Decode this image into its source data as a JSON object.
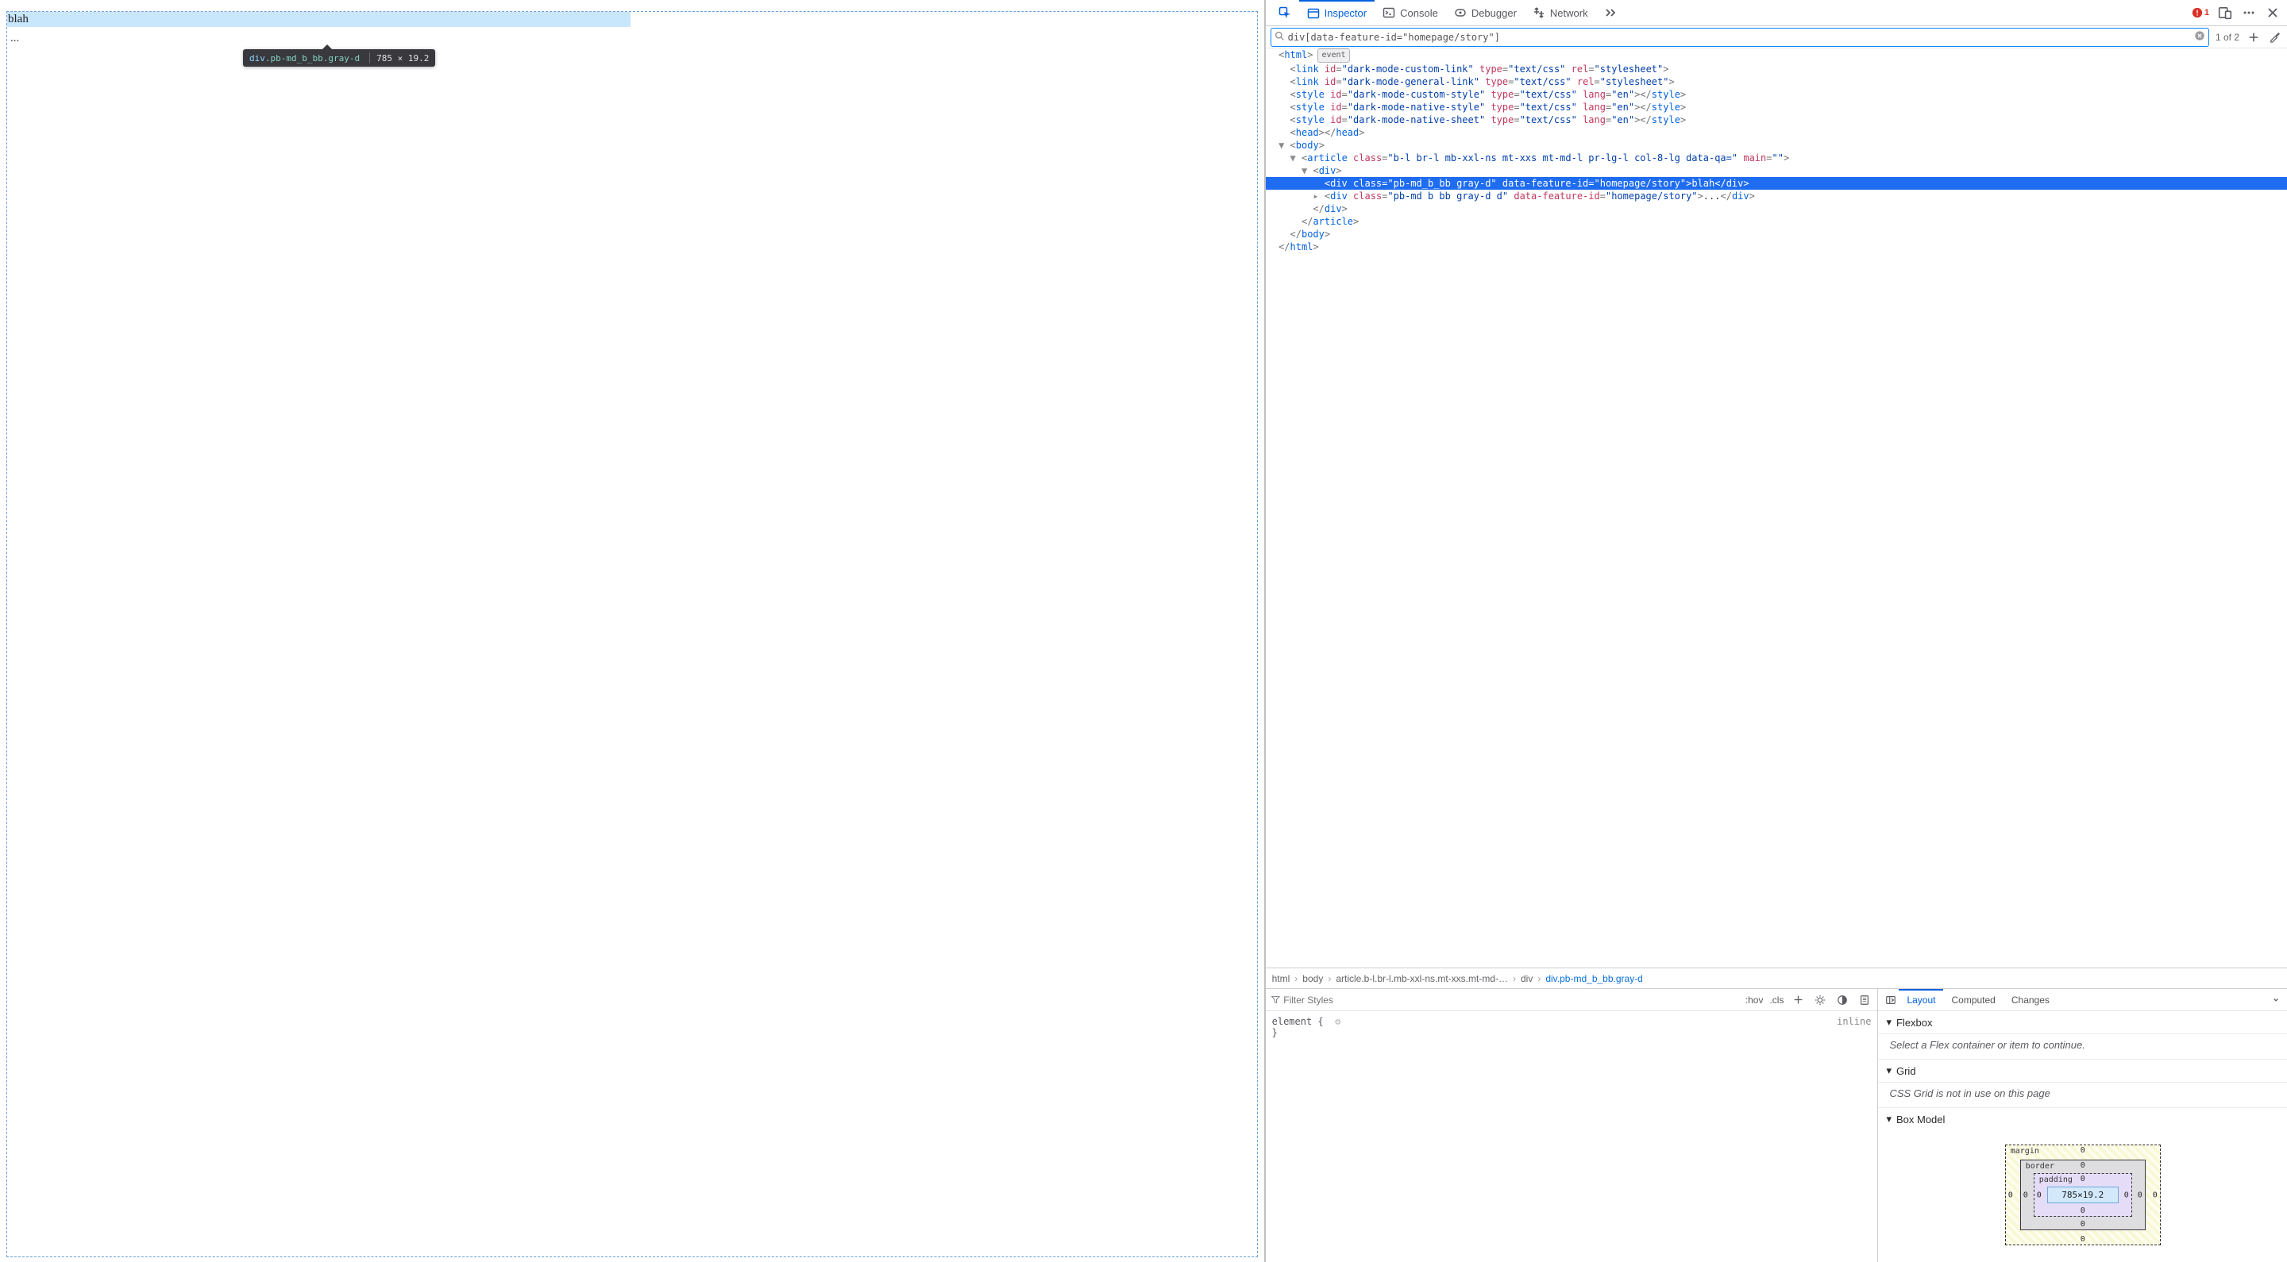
{
  "content": {
    "highlighted_text": "blah",
    "second_line": "...",
    "tooltip_tag": "div",
    "tooltip_classes": ".pb-md_b_bb.gray-d",
    "tooltip_dims": "785 × 19.2"
  },
  "tabs": {
    "inspector": "Inspector",
    "console": "Console",
    "debugger": "Debugger",
    "network": "Network",
    "error_count": "1"
  },
  "search": {
    "query": "div[data-feature-id=\"homepage/story\"]",
    "count": "1 of 2"
  },
  "dom": {
    "l0": "<html>",
    "l0_badge": "event",
    "l1a_name": "id",
    "l1a_val": "\"dark-mode-custom-link\"",
    "l1b_name": "type",
    "l1b_val": "\"text/css\"",
    "l1c_name": "rel",
    "l1c_val": "\"stylesheet\"",
    "l2a_val": "\"dark-mode-general-link\"",
    "l3a_val": "\"dark-mode-custom-style\"",
    "l3_lang": "\"en\"",
    "l4a_val": "\"dark-mode-native-style\"",
    "l5a_val": "\"dark-mode-native-sheet\"",
    "head_close": "<head></head>",
    "art_class": "\"b-l br-l mb-xxl-ns mt-xxs mt-md-l pr-lg-l col-8-lg data-qa=\"",
    "art_main_attr": "main",
    "art_main_val": "\"\"",
    "sel_class": "\"pb-md_b_bb gray-d\"",
    "sel_feat": "\"homepage/story\"",
    "sel_txt": "blah",
    "sib_class": "\"pb-md b bb gray-d d\"",
    "sib_txt": "..."
  },
  "crumbs": {
    "c0": "html",
    "c1": "body",
    "c2": "article.b-l.br-l.mb-xxl-ns.mt-xxs.mt-md-…",
    "c3": "div",
    "c4": "div.pb-md_b_bb.gray-d"
  },
  "rules": {
    "filter_placeholder": "Filter Styles",
    "hov": ":hov",
    "cls": ".cls",
    "element_open": "element {",
    "element_close": "}",
    "inline": "inline"
  },
  "layout_tabs": {
    "layout": "Layout",
    "computed": "Computed",
    "changes": "Changes"
  },
  "layout": {
    "flexbox": "Flexbox",
    "flexbox_msg": "Select a Flex container or item to continue.",
    "grid": "Grid",
    "grid_msg": "CSS Grid is not in use on this page",
    "boxmodel": "Box Model",
    "margin_label": "margin",
    "border_label": "border",
    "padding_label": "padding",
    "content_dims": "785×19.2",
    "zero": "0",
    "dash": "-"
  }
}
